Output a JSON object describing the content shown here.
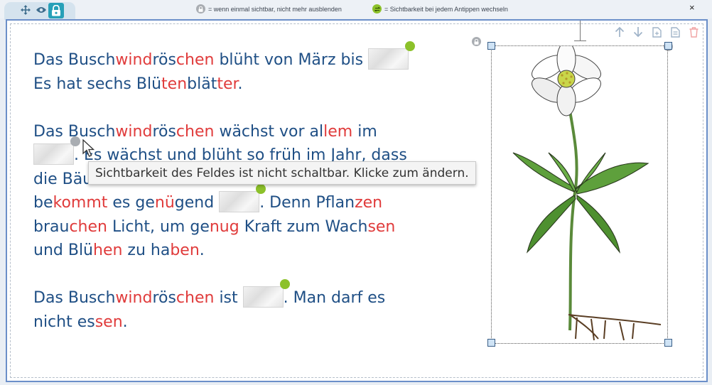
{
  "toolbar": {
    "icons": [
      "move-icon",
      "eye-icon",
      "visibility-lock-icon"
    ]
  },
  "legend": {
    "once_visible": "= wenn einmal sichtbar, nicht mehr ausblenden",
    "toggle_visibility": "= Sichtbarkeit bei jedem Antippen wechseln"
  },
  "window": {
    "close_label": "×"
  },
  "text": {
    "p1": [
      [
        {
          "t": "Das Busch"
        },
        {
          "t": "wind",
          "r": 1
        },
        {
          "t": "rös"
        },
        {
          "t": "chen",
          "r": 1
        },
        {
          "t": " blüht von März bis "
        },
        {
          "gap": "green"
        }
      ],
      [
        {
          "t": "Es hat sechs Blü"
        },
        {
          "t": "ten",
          "r": 1
        },
        {
          "t": "blät"
        },
        {
          "t": "ter",
          "r": 1
        },
        {
          "t": "."
        }
      ]
    ],
    "p2": [
      [
        {
          "t": "Das Busch"
        },
        {
          "t": "wind",
          "r": 1
        },
        {
          "t": "rös"
        },
        {
          "t": "chen",
          "r": 1
        },
        {
          "t": " wächst vor al"
        },
        {
          "t": "lem",
          "r": 1
        },
        {
          "t": " im"
        }
      ],
      [
        {
          "gap": "grey"
        },
        {
          "t": ". Es wächst und blüht so früh im Jahr, dass"
        }
      ],
      [
        {
          "t": "die Bäume noch keine Blätter haben. Es Bäume"
        }
      ],
      [
        {
          "t": "be"
        },
        {
          "t": "kommt",
          "r": 1
        },
        {
          "t": " es ge"
        },
        {
          "t": "nü",
          "r": 1
        },
        {
          "t": "gend "
        },
        {
          "gap": "green"
        },
        {
          "t": ". Denn Pflan"
        },
        {
          "t": "zen",
          "r": 1
        }
      ],
      [
        {
          "t": "brau"
        },
        {
          "t": "chen",
          "r": 1
        },
        {
          "t": " Licht, um ge"
        },
        {
          "t": "nug",
          "r": 1
        },
        {
          "t": " Kraft zum Wach"
        },
        {
          "t": "sen",
          "r": 1
        }
      ],
      [
        {
          "t": "und Blü"
        },
        {
          "t": "hen",
          "r": 1
        },
        {
          "t": " zu ha"
        },
        {
          "t": "ben",
          "r": 1
        },
        {
          "t": "."
        }
      ]
    ],
    "p3": [
      [
        {
          "t": "Das Busch"
        },
        {
          "t": "wind",
          "r": 1
        },
        {
          "t": "rös"
        },
        {
          "t": "chen",
          "r": 1
        },
        {
          "t": " ist "
        },
        {
          "gap": "green"
        },
        {
          "t": ". Man darf es"
        }
      ],
      [
        {
          "t": "nicht es"
        },
        {
          "t": "sen",
          "r": 1
        },
        {
          "t": "."
        }
      ]
    ]
  },
  "tooltip": {
    "text": "Sichtbarkeit des Feldes ist nicht schaltbar. Klicke zum ändern."
  },
  "actions": [
    "arrow-up-icon",
    "arrow-down-icon",
    "duplicate-icon",
    "add-page-icon",
    "trash-icon"
  ],
  "image": {
    "subject_icon": "wood-anemone-illustration"
  },
  "colors": {
    "text": "#1f4f85",
    "syllable_red": "#e03b3b",
    "accent_teal": "#27a0b8",
    "badge_green": "#8cc12a",
    "badge_grey": "#a9adb2",
    "panel_border": "#6b8fc9"
  }
}
